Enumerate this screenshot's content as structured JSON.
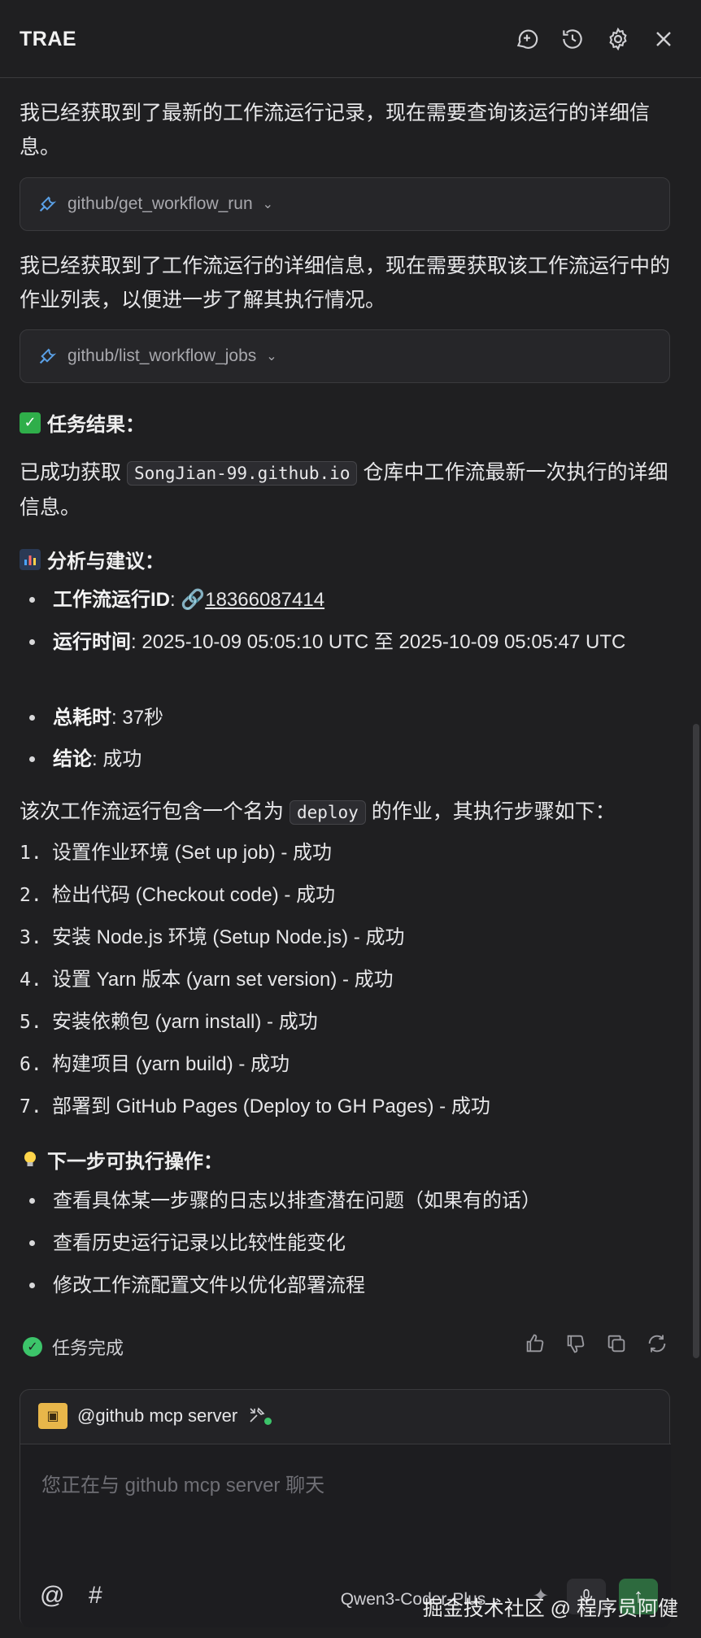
{
  "header": {
    "title": "TRAE",
    "icons": [
      "new-chat-icon",
      "history-icon",
      "settings-icon",
      "close-icon"
    ]
  },
  "messages": {
    "p1": "我已经获取到了最新的工作流运行记录，现在需要查询该运行的详细信息。",
    "tool1": "github/get_workflow_run",
    "p2": "我已经获取到了工作流运行的详细信息，现在需要获取该工作流运行中的作业列表，以便进一步了解其执行情况。",
    "tool2": "github/list_workflow_jobs"
  },
  "result": {
    "heading": "任务结果：",
    "text_before": "已成功获取",
    "repo": "SongJian-99.github.io",
    "text_after": "仓库中工作流最新一次执行的详细信息。"
  },
  "analysis": {
    "heading": "分析与建议：",
    "items": [
      {
        "label": "工作流运行ID",
        "sep": ": ",
        "value": "18366087414"
      },
      {
        "label": "运行时间",
        "sep": ": ",
        "value": "2025-10-09 05:05:10 UTC 至 2025-10-09 05:05:47 UTC"
      },
      {
        "label": "总耗时",
        "sep": ": ",
        "value": "37秒"
      },
      {
        "label": "结论",
        "sep": ": ",
        "value": "成功"
      }
    ]
  },
  "jobs": {
    "intro_before": "该次工作流运行包含一个名为",
    "job_name": "deploy",
    "intro_after": "的作业，其执行步骤如下：",
    "steps": [
      {
        "n": "1.",
        "text": "设置作业环境 (Set up job) - 成功"
      },
      {
        "n": "2.",
        "text": "检出代码 (Checkout code) - 成功"
      },
      {
        "n": "3.",
        "text": "安装 Node.js 环境 (Setup Node.js) - 成功"
      },
      {
        "n": "4.",
        "text": "设置 Yarn 版本 (yarn set version) - 成功"
      },
      {
        "n": "5.",
        "text": "安装依赖包 (yarn install) - 成功"
      },
      {
        "n": "6.",
        "text": "构建项目 (yarn build) - 成功"
      },
      {
        "n": "7.",
        "text": "部署到 GitHub Pages (Deploy to GH Pages) - 成功"
      }
    ]
  },
  "next": {
    "heading": "下一步可执行操作：",
    "items": [
      "查看具体某一步骤的日志以排查潜在问题（如果有的话）",
      "查看历史运行记录以比较性能变化",
      "修改工作流配置文件以优化部署流程"
    ]
  },
  "status": {
    "done_label": "任务完成"
  },
  "chat": {
    "mention": "@github mcp server",
    "placeholder": "您正在与 github mcp server 聊天",
    "at_symbol": "@",
    "hash_symbol": "#",
    "model": "Qwen3-Coder-Plus"
  },
  "watermark": "掘金技术社区 @ 程序员阿健",
  "colors": {
    "background": "#1f1f21",
    "success": "#3cc46a",
    "send_button": "#2d6a3e",
    "mcp_icon": "#e8b64a"
  }
}
